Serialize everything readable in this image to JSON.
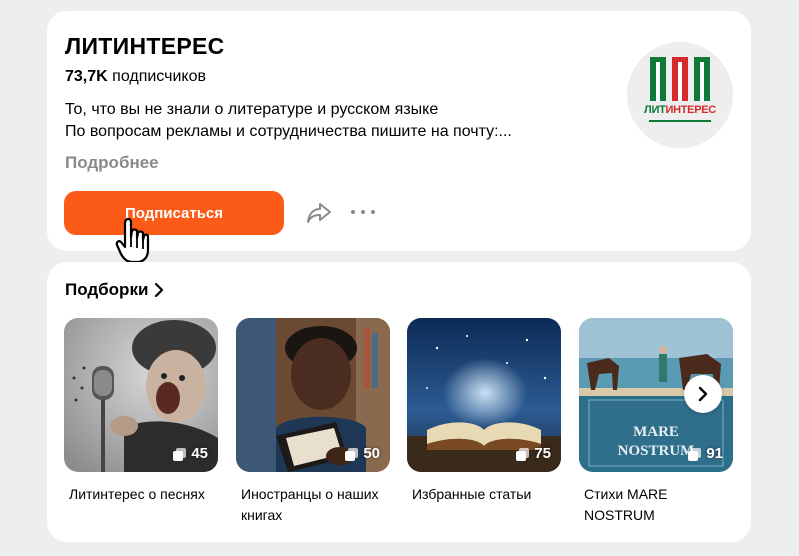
{
  "channel": {
    "title": "ЛИТИНТЕРЕС",
    "subscribers_count": "73,7K",
    "subscribers_label": "подписчиков",
    "description_line1": "То, что вы не знали о литературе и русском языке",
    "description_line2": "По вопросам рекламы и сотрудничества пишите на почту:...",
    "more_label": "Подробнее",
    "subscribe_label": "Подписаться",
    "logo_text_part1": "ЛИТ",
    "logo_text_part2": "ИНТЕРЕС",
    "colors": {
      "accent": "#fc5b17",
      "logo_green": "#0f7a3a",
      "logo_red": "#d52b2b"
    }
  },
  "collections": {
    "heading": "Подборки",
    "items": [
      {
        "label": "Литинтерес о песнях",
        "count": "45"
      },
      {
        "label": "Иностранцы о наших книгах",
        "count": "50"
      },
      {
        "label": "Избранные статьи",
        "count": "75"
      },
      {
        "label": "Стихи MARE NOSTRUM",
        "count": "91"
      }
    ],
    "thumb4_title1": "MARE",
    "thumb4_title2": "NOSTRUM"
  }
}
